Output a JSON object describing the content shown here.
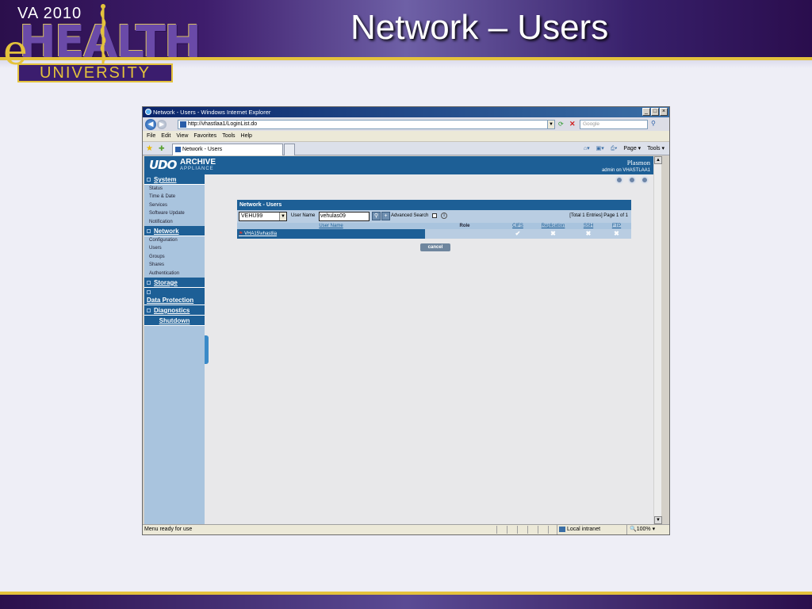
{
  "slide": {
    "title": "Network – Users",
    "logo": {
      "va": "VA 2010",
      "e": "e",
      "health": "HEALTH",
      "university": "UNIVERSITY"
    }
  },
  "browser": {
    "title": "Network - Users - Windows Internet Explorer",
    "window_buttons": [
      "_",
      "□",
      "×"
    ],
    "url": "http://vhastlaa1/LoginList.do",
    "search_placeholder": "Google",
    "menu": [
      "File",
      "Edit",
      "View",
      "Favorites",
      "Tools",
      "Help"
    ],
    "tab": "Network - Users",
    "commands": {
      "page": "Page",
      "tools": "Tools"
    },
    "status": "Menu ready for use",
    "zone": "Local intranet",
    "zoom": "100%"
  },
  "app": {
    "brand": "UDO",
    "archive": "ARCHIVE",
    "appliance": "APPLIANCE",
    "vendor": "Plasmon",
    "user": "admin on VHASTLAA1"
  },
  "sidebar": {
    "system": "System",
    "system_items": [
      "Status",
      "Time & Date",
      "Services",
      "Software Update",
      "Notification"
    ],
    "network": "Network",
    "network_items": [
      "Configuration",
      "Users",
      "Groups",
      "Shares",
      "Authentication"
    ],
    "storage": "Storage",
    "data_protection": "Data Protection",
    "diagnostics": "Diagnostics",
    "shutdown": "Shutdown"
  },
  "panel": {
    "title": "Network - Users",
    "domain": "VEHU99",
    "user_name_label": "User Name",
    "user_name_value": "vehulas09",
    "advanced_search": "Advanced Search",
    "total": "[Total 1 Entries] Page 1 of 1",
    "columns": [
      "User Name",
      "Role",
      "CIFS",
      "Replication",
      "SSH",
      "FTP"
    ],
    "rows": [
      {
        "user": "VHA15\\vhastlia",
        "role": "",
        "cifs": "✔",
        "replication": "✖",
        "ssh": "✖",
        "ftp": "✖"
      }
    ],
    "cancel": "cancel"
  }
}
